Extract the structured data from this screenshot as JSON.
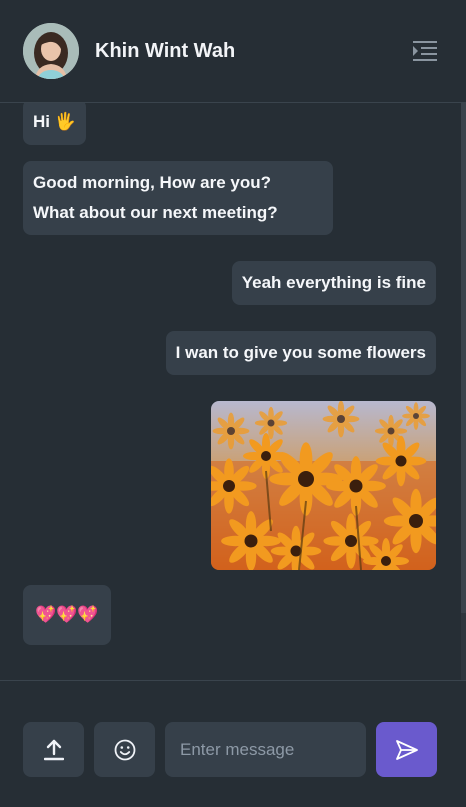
{
  "header": {
    "contact_name": "Khin Wint Wah",
    "avatar_icon": "user-avatar-photo",
    "menu_icon": "menu-lines-icon"
  },
  "messages": [
    {
      "side": "left",
      "lines": [
        "Hi 🖐"
      ]
    },
    {
      "side": "left",
      "lines": [
        "Good morning, How are you?",
        "What about our next meeting?"
      ]
    },
    {
      "side": "right",
      "lines": [
        "Yeah everything is fine"
      ]
    },
    {
      "side": "right",
      "lines": [
        "I wan to give you some flowers"
      ]
    },
    {
      "side": "right",
      "type": "image",
      "content": "orange-flowers-photo"
    },
    {
      "side": "left",
      "lines": [
        "💖💖💖"
      ]
    }
  ],
  "composer": {
    "upload_icon": "upload-icon",
    "emoji_icon": "emoji-smile-icon",
    "placeholder": "Enter message",
    "send_icon": "send-paper-plane-icon"
  },
  "colors": {
    "background": "#262e35",
    "bubble": "#36404a",
    "accent": "#6a5acd",
    "text": "#eff2f7"
  }
}
